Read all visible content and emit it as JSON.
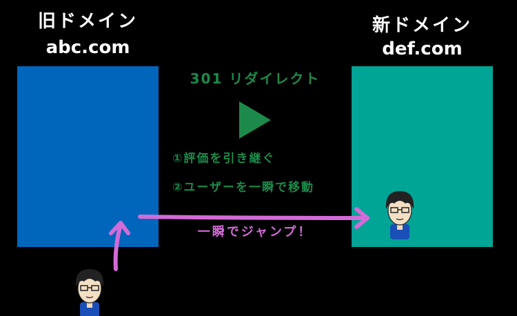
{
  "old_domain": {
    "title": "旧ドメイン",
    "domain": "abc.com",
    "color": "#0066bb"
  },
  "new_domain": {
    "title": "新ドメイン",
    "domain": "def.com",
    "color": "#00a596"
  },
  "redirect": {
    "title": "301 リダイレクト",
    "text_color": "#1c8a4a",
    "benefits": [
      "①評価を引き継ぐ",
      "②ユーザーを一瞬で移動"
    ]
  },
  "jump": {
    "label": "一瞬でジャンプ！",
    "color": "#d46ad8"
  },
  "icons": [
    "play-icon",
    "user-avatar"
  ]
}
